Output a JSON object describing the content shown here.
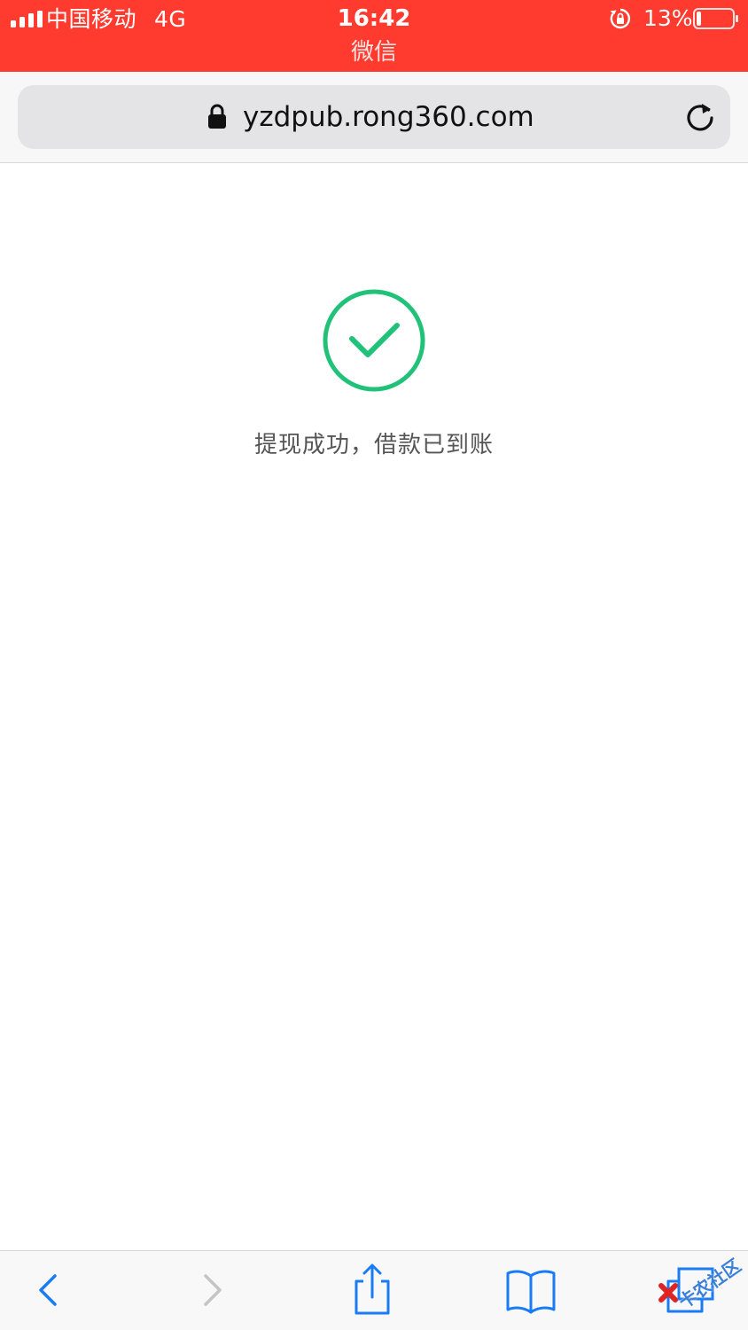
{
  "status_bar": {
    "carrier": "中国移动",
    "network": "4G",
    "time": "16:42",
    "app_name": "微信",
    "battery_percent": "13%",
    "battery_level": 0.13,
    "background_color": "#ff3b30"
  },
  "address_bar": {
    "url": "yzdpub.rong360.com",
    "secure_icon": "padlock-icon",
    "reload_icon": "reload-icon"
  },
  "content": {
    "status_icon": "check-circle-icon",
    "status_icon_color": "#20c178",
    "message": "提现成功，借款已到账"
  },
  "toolbar": {
    "items": [
      {
        "name": "back",
        "icon": "chevron-left-icon"
      },
      {
        "name": "forward",
        "icon": "chevron-right-icon"
      },
      {
        "name": "share",
        "icon": "share-icon"
      },
      {
        "name": "bookmarks",
        "icon": "book-icon"
      },
      {
        "name": "tabs",
        "icon": "tabs-icon"
      }
    ],
    "accent_color": "#1a7cf5"
  },
  "watermark": {
    "text": "卡农社区"
  }
}
